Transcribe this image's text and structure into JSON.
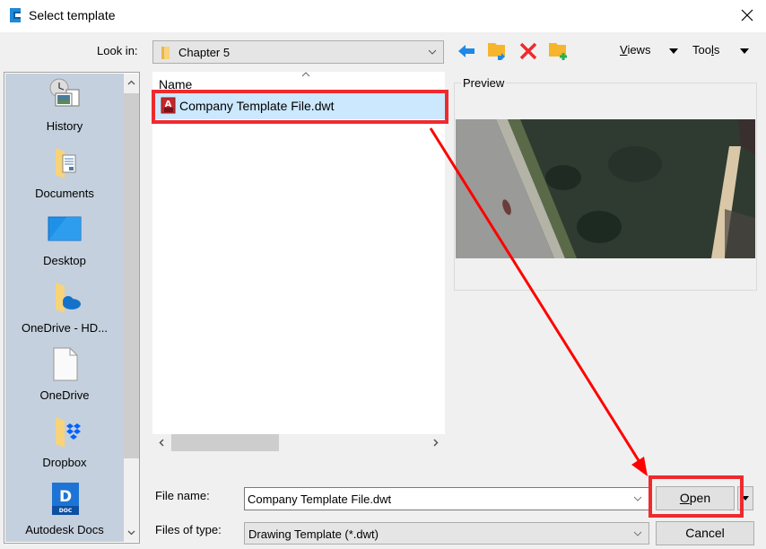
{
  "window": {
    "title": "Select template"
  },
  "toolbar": {
    "look_in_label": "Look in:",
    "look_in_value": "Chapter 5",
    "icons": [
      "back-arrow-icon",
      "up-one-level-icon",
      "delete-icon",
      "create-new-folder-icon"
    ],
    "views_label_underline": "V",
    "views_label_rest": "iews",
    "tools_label_pre": "Too",
    "tools_label_underline": "l",
    "tools_label_post": "s"
  },
  "places": {
    "items": [
      {
        "label": "History",
        "icon": "history-icon"
      },
      {
        "label": "Documents",
        "icon": "documents-folder-icon"
      },
      {
        "label": "Desktop",
        "icon": "desktop-icon"
      },
      {
        "label": "OneDrive - HD...",
        "icon": "onedrive-folder-icon"
      },
      {
        "label": "OneDrive",
        "icon": "blank-document-icon"
      },
      {
        "label": "Dropbox",
        "icon": "dropbox-folder-icon"
      },
      {
        "label": "Autodesk Docs",
        "icon": "autodesk-docs-icon"
      }
    ]
  },
  "file_list": {
    "column_header": "Name",
    "files": [
      {
        "name": "Company Template File.dwt",
        "icon": "dwt-file-icon",
        "selected": true
      }
    ]
  },
  "preview": {
    "label": "Preview"
  },
  "bottom": {
    "file_name_label": "File name:",
    "file_name_value": "Company Template File.dwt",
    "file_type_label": "Files of type:",
    "file_type_value": "Drawing Template (*.dwt)",
    "open_underline": "O",
    "open_rest": "pen",
    "cancel_label": "Cancel"
  },
  "annotations": {
    "highlight_color": "#ee2a2f",
    "arrow_color": "#ff0000"
  }
}
